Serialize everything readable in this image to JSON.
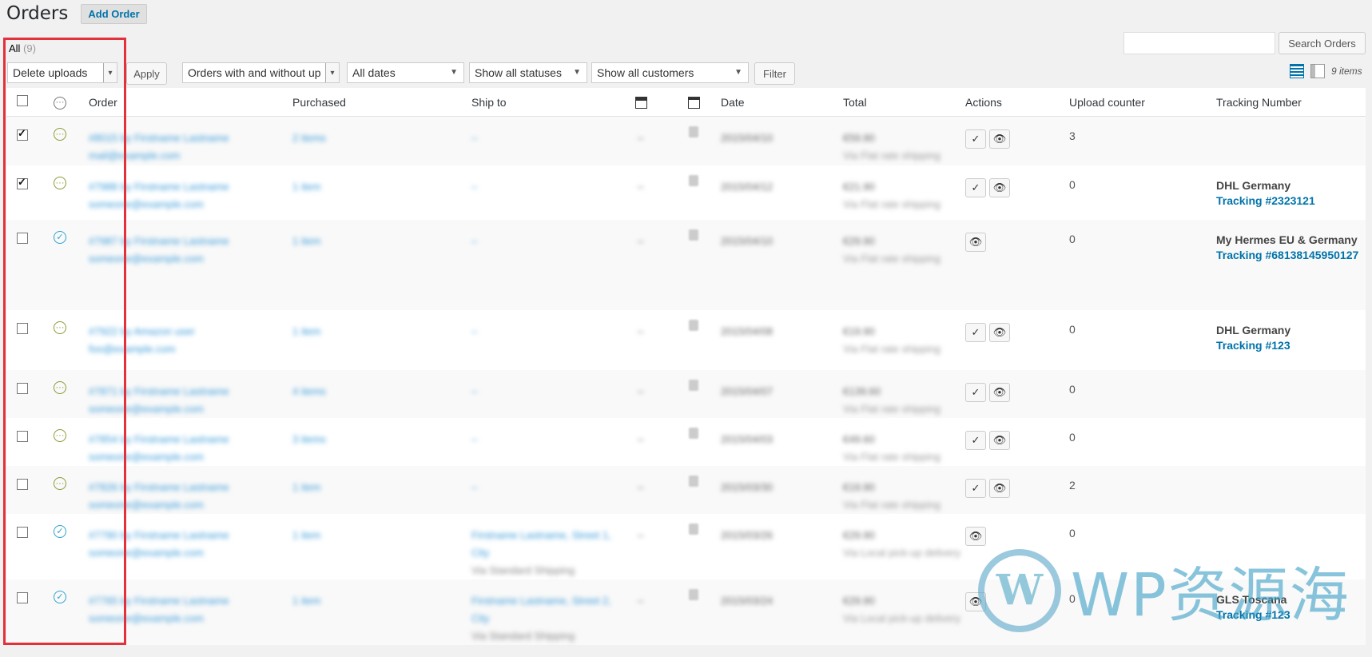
{
  "header": {
    "title": "Orders",
    "add_label": "Add Order"
  },
  "search": {
    "button_label": "Search Orders",
    "placeholder": ""
  },
  "views": {
    "all_label": "All",
    "all_count": "(9)"
  },
  "toolbar": {
    "bulk_action": "Delete uploads",
    "apply_label": "Apply",
    "order_filter": "Orders with and without up",
    "date_filter": "All dates",
    "status_filter": "Show all statuses",
    "customer_filter": "Show all customers",
    "filter_label": "Filter",
    "items_count": "9 items"
  },
  "columns": {
    "order": "Order",
    "purchased": "Purchased",
    "ship_to": "Ship to",
    "date": "Date",
    "total": "Total",
    "actions": "Actions",
    "upload_counter": "Upload counter",
    "tracking": "Tracking Number"
  },
  "rows": [
    {
      "checked": true,
      "status": "processing",
      "order": "#8015 by Firstname Lastname",
      "email": "mail@example.com",
      "purchased": "2 items",
      "ship": "–",
      "ship_note": "",
      "date": "2015/04/10",
      "total": "€59.90",
      "total_note": "Via Flat rate shipping",
      "actions": [
        "complete",
        "view"
      ],
      "uploads": "3",
      "provider": "",
      "tracking": ""
    },
    {
      "checked": true,
      "status": "processing",
      "order": "#7988 by Firstname Lastname",
      "email": "someone@example.com",
      "purchased": "1 item",
      "ship": "–",
      "ship_note": "",
      "date": "2015/04/12",
      "total": "€21.90",
      "total_note": "Via Flat rate shipping",
      "actions": [
        "complete",
        "view"
      ],
      "uploads": "0",
      "provider": "DHL Germany",
      "tracking": "Tracking #2323121"
    },
    {
      "checked": false,
      "status": "completed",
      "order": "#7987 by Firstname Lastname",
      "email": "someone@example.com",
      "purchased": "1 item",
      "ship": "–",
      "ship_note": "",
      "date": "2015/04/10",
      "total": "€29.90",
      "total_note": "Via Flat rate shipping",
      "actions": [
        "view"
      ],
      "uploads": "0",
      "provider": "My Hermes EU & Germany",
      "tracking": "Tracking #68138145950127"
    },
    {
      "checked": false,
      "status": "processing",
      "order": "#7922 by Amazon user",
      "email": "foo@example.com",
      "purchased": "1 item",
      "ship": "–",
      "ship_note": "",
      "date": "2015/04/08",
      "total": "€19.90",
      "total_note": "Via Flat rate shipping",
      "actions": [
        "complete",
        "view"
      ],
      "uploads": "0",
      "provider": "DHL Germany",
      "tracking": "Tracking #123"
    },
    {
      "checked": false,
      "status": "processing",
      "order": "#7871 by Firstname Lastname",
      "email": "someone@example.com",
      "purchased": "4 items",
      "ship": "–",
      "ship_note": "",
      "date": "2015/04/07",
      "total": "€139.60",
      "total_note": "Via Flat rate shipping",
      "actions": [
        "complete",
        "view"
      ],
      "uploads": "0",
      "provider": "",
      "tracking": ""
    },
    {
      "checked": false,
      "status": "processing",
      "order": "#7854 by Firstname Lastname",
      "email": "someone@example.com",
      "purchased": "3 items",
      "ship": "–",
      "ship_note": "",
      "date": "2015/04/03",
      "total": "€49.60",
      "total_note": "Via Flat rate shipping",
      "actions": [
        "complete",
        "view"
      ],
      "uploads": "0",
      "provider": "",
      "tracking": ""
    },
    {
      "checked": false,
      "status": "processing",
      "order": "#7826 by Firstname Lastname",
      "email": "someone@example.com",
      "purchased": "1 item",
      "ship": "–",
      "ship_note": "",
      "date": "2015/03/30",
      "total": "€19.90",
      "total_note": "Via Flat rate shipping",
      "actions": [
        "complete",
        "view"
      ],
      "uploads": "2",
      "provider": "",
      "tracking": ""
    },
    {
      "checked": false,
      "status": "completed",
      "order": "#7790 by Firstname Lastname",
      "email": "someone@example.com",
      "purchased": "1 item",
      "ship": "Firstname Lastname, Street 1, City",
      "ship_note": "Via Standard Shipping",
      "date": "2015/03/26",
      "total": "€29.90",
      "total_note": "Via Local pick-up delivery",
      "actions": [
        "view"
      ],
      "uploads": "0",
      "provider": "",
      "tracking": ""
    },
    {
      "checked": false,
      "status": "completed",
      "order": "#7765 by Firstname Lastname",
      "email": "someone@example.com",
      "purchased": "1 item",
      "ship": "Firstname Lastname, Street 2, City",
      "ship_note": "Via Standard Shipping",
      "date": "2015/03/24",
      "total": "€29.90",
      "total_note": "Via Local pick-up delivery",
      "actions": [
        "view"
      ],
      "uploads": "0",
      "provider": "GLS Toscana",
      "tracking": "Tracking #123"
    }
  ],
  "watermark": {
    "logo": "W",
    "text": "WP资源海"
  },
  "colors": {
    "link": "#0073aa",
    "highlight": "#e3313b",
    "processing": "#8a9b34",
    "completed": "#2ea2cc"
  }
}
